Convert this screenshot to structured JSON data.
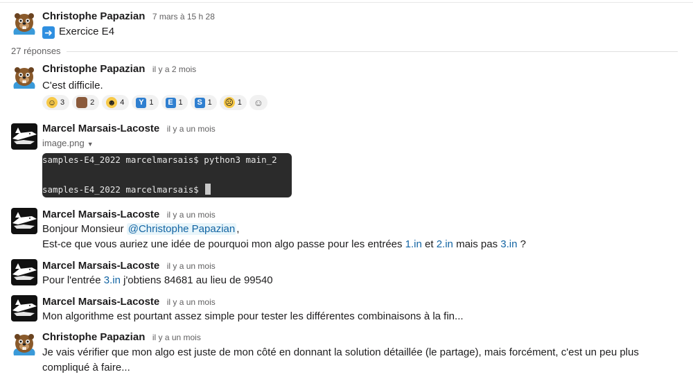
{
  "parent": {
    "author": "Christophe Papazian",
    "time": "7 mars à 15 h 28",
    "text": "Exercice E4",
    "emoji_icon": "arrow-right-emoji"
  },
  "replies_count": "27 réponses",
  "messages": [
    {
      "author": "Christophe Papazian",
      "time": "il y a 2 mois",
      "text": "C'est difficile.",
      "reactions": [
        {
          "emoji": "grinning-sweat-icon",
          "count": "3"
        },
        {
          "emoji": "brown-figure-icon",
          "count": "2"
        },
        {
          "emoji": "rofl-icon",
          "count": "4"
        },
        {
          "emoji": "letter-y-icon",
          "letter": "Y",
          "count": "1"
        },
        {
          "emoji": "letter-e-icon",
          "letter": "E",
          "count": "1"
        },
        {
          "emoji": "letter-s-icon",
          "letter": "S",
          "count": "1"
        },
        {
          "emoji": "pensive-icon",
          "count": "1"
        }
      ]
    },
    {
      "author": "Marcel Marsais-Lacoste",
      "time": "il y a un mois",
      "file_name": "image.png",
      "code_lines": [
        "samples-E4_2022 marcelmarsais$ python3 main_2",
        "samples-E4_2022 marcelmarsais$ "
      ]
    },
    {
      "author": "Marcel Marsais-Lacoste",
      "time": "il y a un mois",
      "line1_prefix": "Bonjour Monsieur ",
      "mention": "@Christophe Papazian",
      "line1_suffix": ",",
      "line2_a": "Est-ce que vous auriez une idée de pourquoi mon algo passe pour les entrées ",
      "link1": "1.in",
      "line2_b": " et ",
      "link2": "2.in",
      "line2_c": " mais pas ",
      "link3": "3.in",
      "line2_d": " ?"
    },
    {
      "author": "Marcel Marsais-Lacoste",
      "time": "il y a un mois",
      "text_a": "Pour l'entrée ",
      "link": "3.in",
      "text_b": " j'obtiens 84681 au lieu de 99540"
    },
    {
      "author": "Marcel Marsais-Lacoste",
      "time": "il y a un mois",
      "text": "Mon algorithme est pourtant assez simple pour tester les différentes combinaisons à la fin..."
    },
    {
      "author": "Christophe Papazian",
      "time": "il y a un mois",
      "text": "Je vais vérifier que mon algo est juste de mon côté en donnant la solution détaillée (le partage), mais forcément, c'est un peu plus compliqué à faire..."
    }
  ]
}
